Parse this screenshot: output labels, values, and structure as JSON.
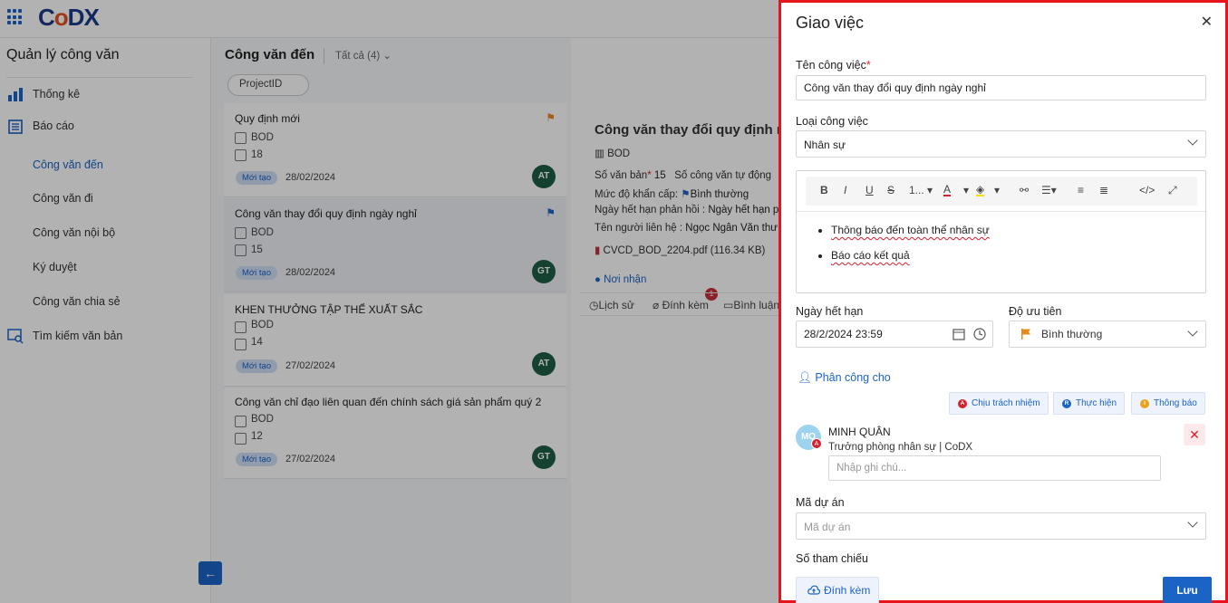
{
  "app": {
    "logo_c": "C",
    "logo_o": "o",
    "logo_dx": "DX"
  },
  "sidebar": {
    "title": "Quản lý công văn",
    "items": [
      {
        "label": "Thống kê",
        "icon": "bar-chart-icon"
      },
      {
        "label": "Báo cáo",
        "icon": "report-icon"
      },
      {
        "label": "Công văn đến",
        "active": true
      },
      {
        "label": "Công văn đi"
      },
      {
        "label": "Công văn nội bộ"
      },
      {
        "label": "Ký duyệt"
      },
      {
        "label": "Công văn chia sẻ"
      },
      {
        "label": "Tìm kiếm văn bản",
        "icon": "search-doc-icon"
      }
    ],
    "collapse_icon": "arrow-left-icon"
  },
  "list": {
    "title": "Công văn đến",
    "filter": "Tất cả (4)",
    "chip": "ProjectID",
    "cards": [
      {
        "title": "Quy định mới",
        "org": "BOD",
        "num": "18",
        "badge": "Mới tạo",
        "date": "28/02/2024",
        "avatar": "AT",
        "flag_color": "#e8891f"
      },
      {
        "title": "Công văn thay đổi quy định ngày nghỉ",
        "org": "BOD",
        "num": "15",
        "badge": "Mới tạo",
        "date": "28/02/2024",
        "avatar": "GT",
        "flag_color": "#1b63c5"
      },
      {
        "title": "KHEN THƯỞNG TẬP THỂ XUẤT SẮC",
        "org": "BOD",
        "num": "14",
        "badge": "Mới tạo",
        "date": "27/02/2024",
        "avatar": "AT"
      },
      {
        "title": "Công văn chỉ đạo liên quan đến chính sách giá sản phẩm quý 2",
        "org": "BOD",
        "num": "12",
        "badge": "Mới tạo",
        "date": "27/02/2024",
        "avatar": "GT"
      }
    ]
  },
  "detail": {
    "title": "Công văn thay đổi quy định ng",
    "org": "BOD",
    "so_van_ban_label": "Số văn bản",
    "so_van_ban": "15",
    "so_cong_van_label": "Số công văn tự động",
    "muc_do_label": "Mức độ khẩn cấp:",
    "muc_do": "Bình thường",
    "han_label": "Ngày hết hạn phản hồi :",
    "han": "Ngày hết hạn p",
    "lien_he_label": "Tên người liên hệ :",
    "lien_he": "Ngọc Ngân Văn thư",
    "file": "CVCD_BOD_2204.pdf (116.34 KB)",
    "noi_nhan": "Nơi nhận",
    "tabs": [
      "Lịch sử",
      "Đính kèm",
      "Bình luận"
    ],
    "attach_count": "1"
  },
  "panel": {
    "title": "Giao việc",
    "ten_cong_viec_label": "Tên công việc",
    "ten_cong_viec": "Công văn thay đổi quy định ngày nghỉ",
    "loai_label": "Loại công việc",
    "loai": "Nhân sự",
    "editor_toolbar": [
      "B",
      "I",
      "U",
      "S",
      "1...",
      "A",
      "</>"
    ],
    "editor_items": [
      "Thông báo đến toàn thể nhân sự",
      "Báo cáo kết quả"
    ],
    "ngay_het_han_label": "Ngày hết hạn",
    "ngay_het_han": "28/2/2024 23:59",
    "do_uu_tien_label": "Độ ưu tiên",
    "do_uu_tien": "Bình thường",
    "phan_cong_label": "Phân công cho",
    "roles": [
      {
        "label": "Chịu trách nhiệm",
        "letter": "A",
        "color": "#d5202e"
      },
      {
        "label": "Thực hiện",
        "letter": "R",
        "color": "#1b63c5"
      },
      {
        "label": "Thông báo",
        "letter": "I",
        "color": "#e8a21f"
      }
    ],
    "person": {
      "initials": "MQ",
      "badge": "A",
      "name": "MINH QUÂN",
      "role": "Trưởng phòng nhân sự | CoDX",
      "note_placeholder": "Nhập ghi chú..."
    },
    "ma_du_an_label": "Mã dự án",
    "ma_du_an_placeholder": "Mã dự án",
    "so_tham_chieu_label": "Số tham chiếu",
    "attach_button": "Đính kèm",
    "save_button": "Lưu"
  }
}
